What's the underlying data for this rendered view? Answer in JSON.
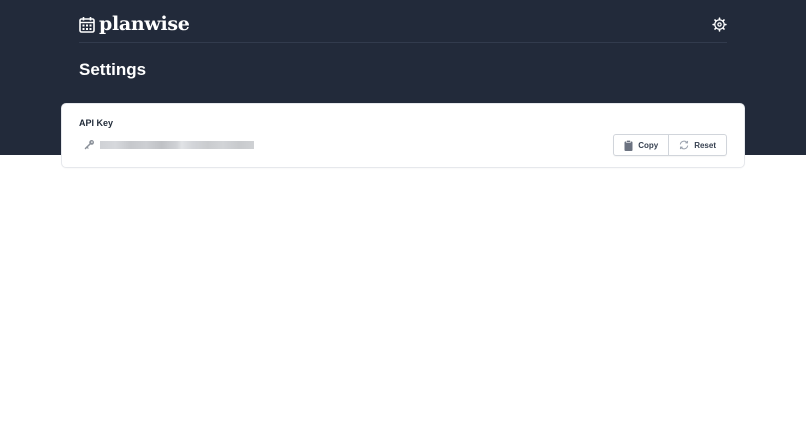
{
  "brand": {
    "name": "planwise"
  },
  "page": {
    "title": "Settings"
  },
  "api_key_card": {
    "label": "API Key",
    "copy_label": "Copy",
    "reset_label": "Reset"
  },
  "icons": {
    "logo": "calendar-icon",
    "settings": "gear-icon",
    "key": "key-icon",
    "copy": "clipboard-icon",
    "reset": "refresh-icon"
  },
  "colors": {
    "header_background": "#222a3a",
    "page_background": "#ffffff",
    "text_primary": "#1f2937"
  }
}
